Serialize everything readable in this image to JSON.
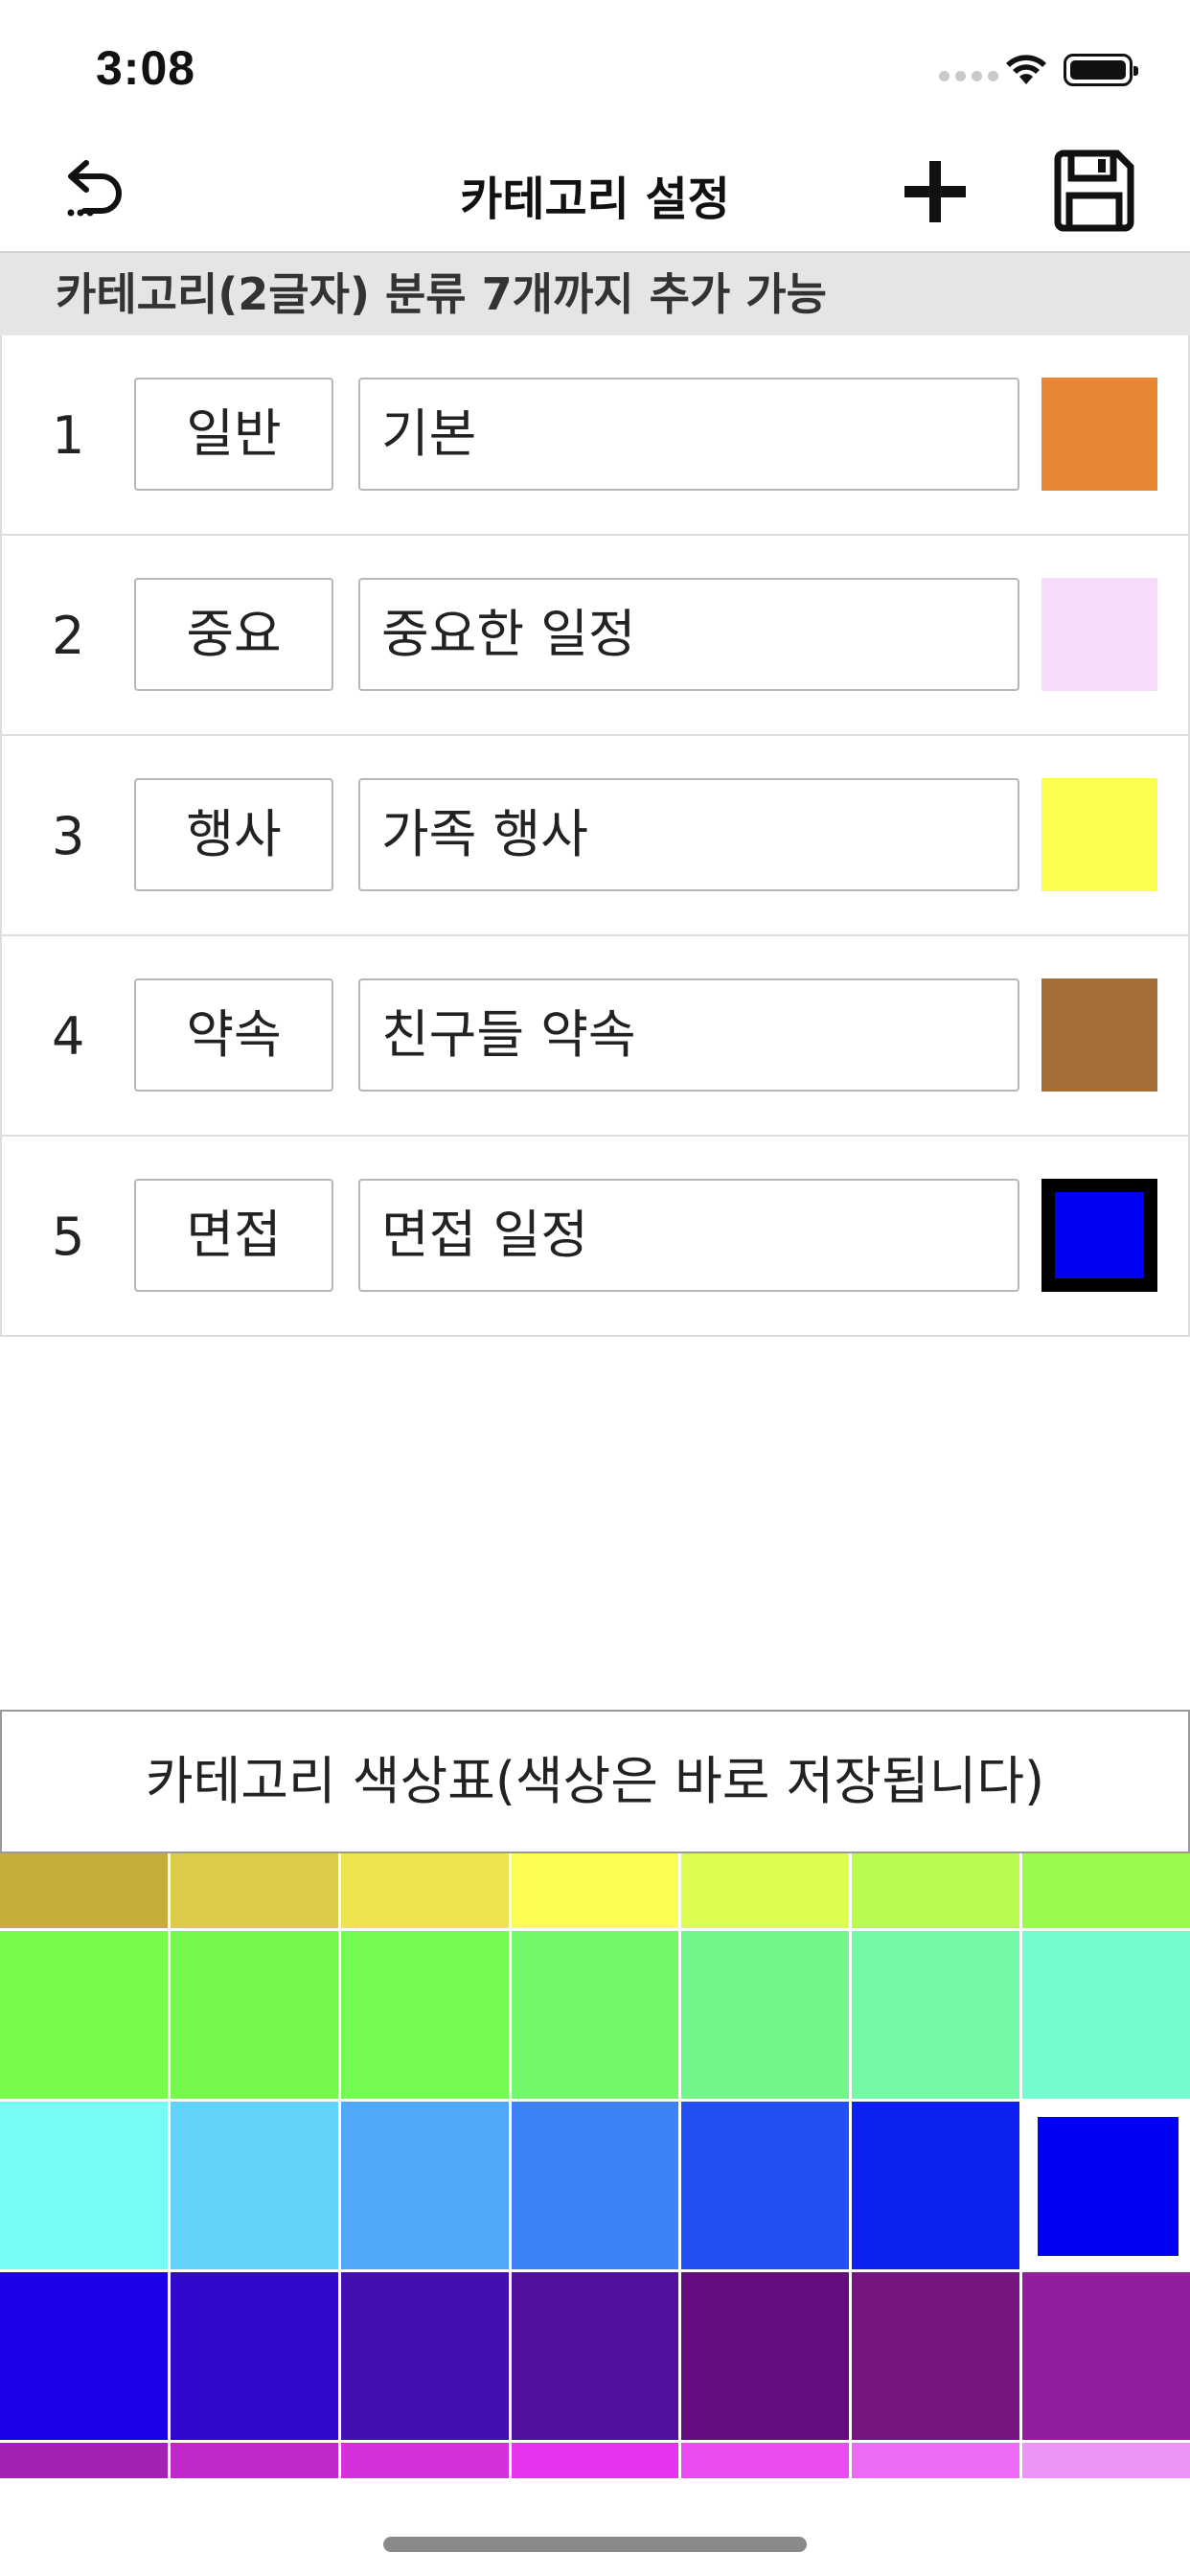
{
  "status_bar": {
    "time": "3:08"
  },
  "nav": {
    "title": "카테고리 설정",
    "back_icon": "undo-arrow-icon",
    "add_icon": "plus-icon",
    "save_icon": "floppy-disk-icon"
  },
  "notice": "카테고리(2글자) 분류 7개까지 추가 가능",
  "categories": [
    {
      "index": "1",
      "name": "일반",
      "description": "기본",
      "color": "#E88634",
      "selected": false
    },
    {
      "index": "2",
      "name": "중요",
      "description": "중요한 일정",
      "color": "#F6DCFA",
      "selected": false
    },
    {
      "index": "3",
      "name": "행사",
      "description": "가족 행사",
      "color": "#FBFF4F",
      "selected": false
    },
    {
      "index": "4",
      "name": "약속",
      "description": "친구들 약속",
      "color": "#A66F38",
      "selected": false
    },
    {
      "index": "5",
      "name": "면접",
      "description": "면접 일정",
      "color": "#0000F5",
      "selected": true
    }
  ],
  "palette": {
    "title": "카테고리 색상표(색상은 바로 저장됩니다)",
    "selected_color": "#0000F5",
    "colors": [
      "#C7AD3B",
      "#DBCB46",
      "#EDE44E",
      "#FBFE55",
      "#DCFC4F",
      "#B9FC50",
      "#9AFB4F",
      "#7BFA4E",
      "#76F94D",
      "#75F953",
      "#73F86C",
      "#72F68C",
      "#74FAA7",
      "#76FBD0",
      "#78FBF5",
      "#63D2F8",
      "#50A9F8",
      "#3C81F5",
      "#2350F3",
      "#0D22F0",
      "#0000F5",
      "#1E00E6",
      "#3208CF",
      "#4210B1",
      "#52109D",
      "#650D7F",
      "#781680",
      "#911E9E",
      "#A520B4",
      "#BF28CA",
      "#D530DC",
      "#E833EE",
      "#EA4CF2",
      "#EC6AF4",
      "#EE94F6"
    ]
  }
}
